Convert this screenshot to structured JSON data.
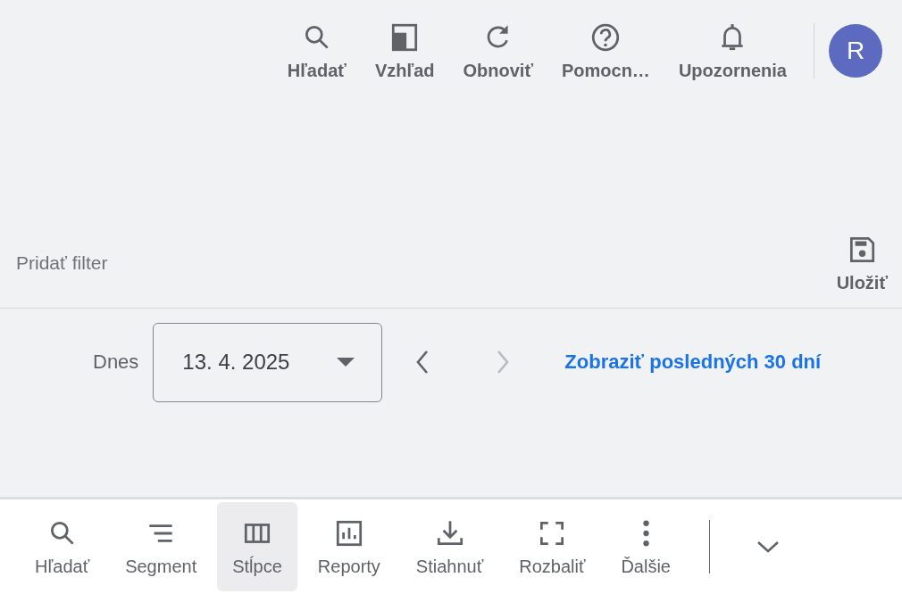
{
  "top_actions": [
    {
      "kind": "search",
      "label": "Hľadať"
    },
    {
      "kind": "layout",
      "label": "Vzhľad"
    },
    {
      "kind": "refresh",
      "label": "Obnoviť"
    },
    {
      "kind": "help",
      "label": "Pomocn…"
    },
    {
      "kind": "bell",
      "label": "Upozornenia"
    }
  ],
  "avatar": {
    "letter": "R",
    "color": "#5c6bc0"
  },
  "filter_bar": {
    "placeholder": "Pridať filter",
    "save": {
      "label": "Uložiť"
    }
  },
  "date_bar": {
    "label": "Dnes",
    "date": "13. 4. 2025",
    "prev_disabled": false,
    "next_disabled": true,
    "link": "Zobraziť posledných 30 dní"
  },
  "bottom_toolbar": [
    {
      "kind": "search",
      "label": "Hľadať",
      "selected": false
    },
    {
      "kind": "segment",
      "label": "Segment",
      "selected": false
    },
    {
      "kind": "columns",
      "label": "Stĺpce",
      "selected": true
    },
    {
      "kind": "reports",
      "label": "Reporty",
      "selected": false
    },
    {
      "kind": "download",
      "label": "Stiahnuť",
      "selected": false
    },
    {
      "kind": "expand",
      "label": "Rozbaliť",
      "selected": false
    },
    {
      "kind": "more",
      "label": "Ďalšie",
      "selected": false
    }
  ]
}
